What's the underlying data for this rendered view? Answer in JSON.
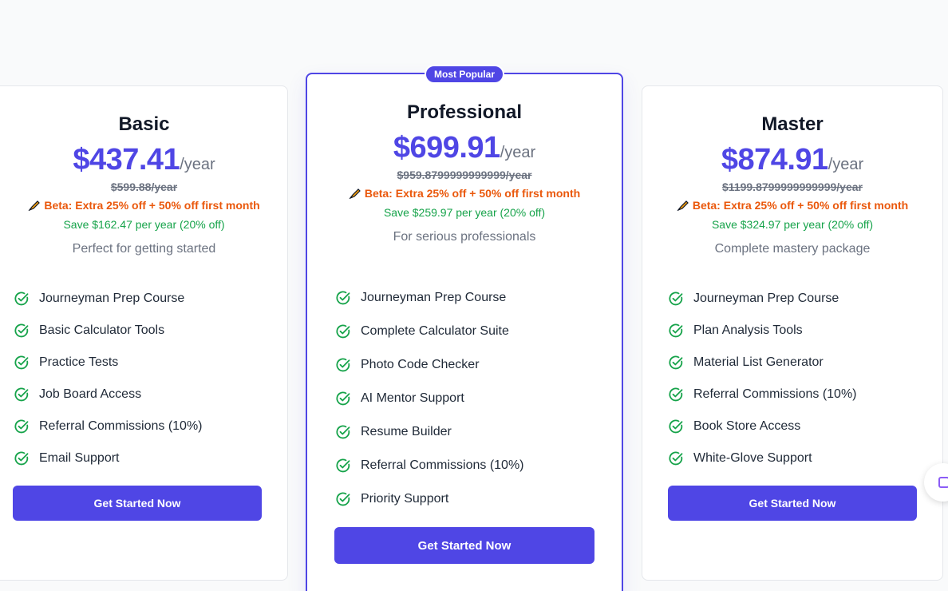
{
  "plans": [
    {
      "name": "Basic",
      "price": "$437.41",
      "period": "/year",
      "original": "$599.88/year",
      "beta": "Beta: Extra 25% off + 50% off first month",
      "save": "Save $162.47 per year (20% off)",
      "tagline": "Perfect for getting started",
      "features": [
        "Journeyman Prep Course",
        "Basic Calculator Tools",
        "Practice Tests",
        "Job Board Access",
        "Referral Commissions (10%)",
        "Email Support"
      ],
      "cta": "Get Started Now"
    },
    {
      "name": "Professional",
      "badge": "Most Popular",
      "price": "$699.91",
      "period": "/year",
      "original": "$959.8799999999999/year",
      "beta": "Beta: Extra 25% off + 50% off first month",
      "save": "Save $259.97 per year (20% off)",
      "tagline": "For serious professionals",
      "features": [
        "Journeyman Prep Course",
        "Complete Calculator Suite",
        "Photo Code Checker",
        "AI Mentor Support",
        "Resume Builder",
        "Referral Commissions (10%)",
        "Priority Support"
      ],
      "cta": "Get Started Now"
    },
    {
      "name": "Master",
      "price": "$874.91",
      "period": "/year",
      "original": "$1199.8799999999999/year",
      "beta": "Beta: Extra 25% off + 50% off first month",
      "save": "Save $324.97 per year (20% off)",
      "tagline": "Complete mastery package",
      "features": [
        "Journeyman Prep Course",
        "Plan Analysis Tools",
        "Material List Generator",
        "Referral Commissions (10%)",
        "Book Store Access",
        "White-Glove Support"
      ],
      "cta": "Get Started Now"
    }
  ],
  "icons": {
    "feature": "check-circle-icon",
    "beta": "pen-icon",
    "floating": "chat-widget-icon"
  },
  "colors": {
    "accent": "#4f46e5",
    "beta": "#ea580c",
    "save": "#16a34a",
    "check": "#16a34a"
  }
}
